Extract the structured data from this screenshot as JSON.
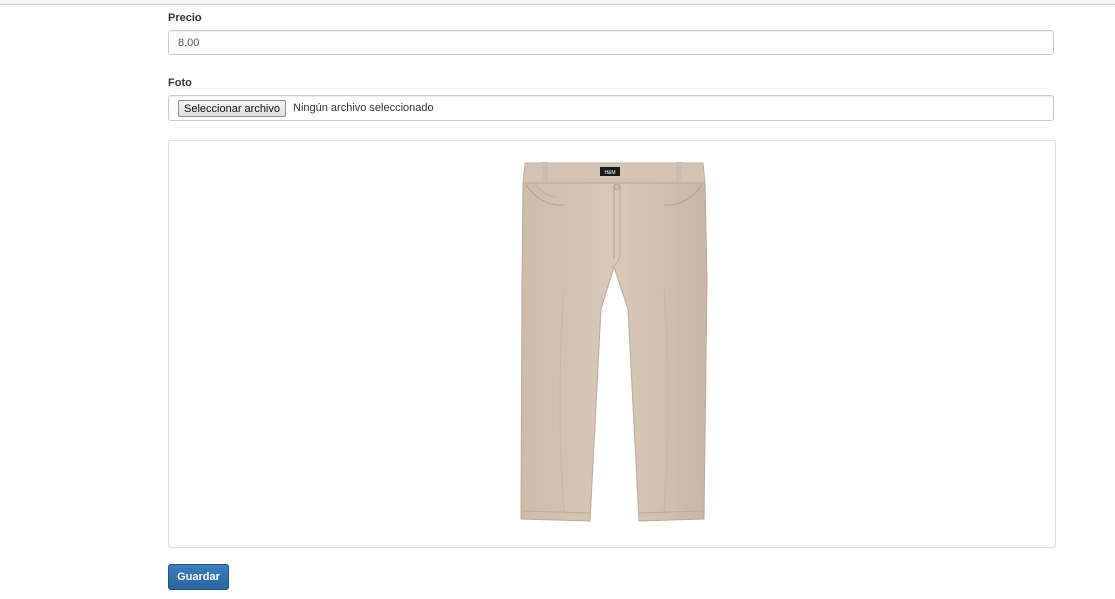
{
  "form": {
    "price": {
      "label": "Precio",
      "value": "8.00"
    },
    "photo": {
      "label": "Foto",
      "button_label": "Seleccionar archivo",
      "status_text": "Ningún archivo seleccionado"
    },
    "preview": {
      "image_subject": "beige-pants",
      "pants_color": "#d3c3b2",
      "brand_logo": "H&M"
    },
    "submit_label": "Guardar"
  }
}
